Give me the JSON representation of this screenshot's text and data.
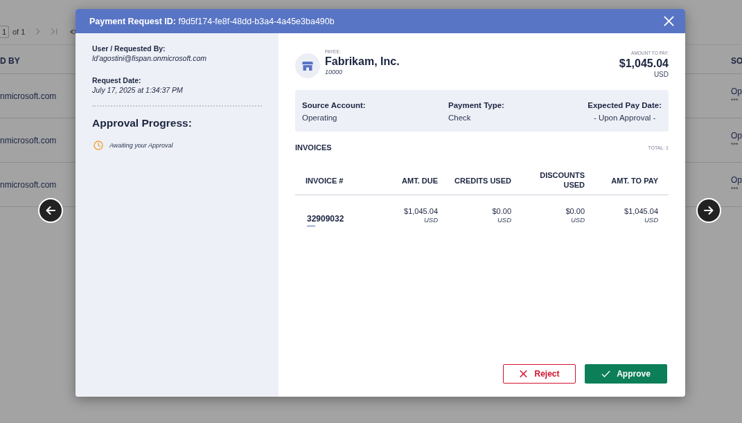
{
  "page": {
    "pagination": {
      "page": "1",
      "of": "of 1"
    },
    "table": {
      "columns": [
        "D BY",
        "SO"
      ],
      "rows": [
        {
          "cells": [
            "nmicrosoft.com",
            "Op"
          ],
          "masked": "***"
        },
        {
          "cells": [
            "nmicrosoft.com",
            "Op"
          ],
          "masked": "***"
        },
        {
          "cells": [
            "nmicrosoft.com",
            "Op"
          ],
          "masked": "***"
        }
      ]
    }
  },
  "modal": {
    "title": "**Payment Request ID:** f9d5f174-fe8f-48dd-b3a4-4a45e3ba490b",
    "details": [
      {
        "label": "User / Requested By:",
        "value": "ld'agostini@fispan.onmicrosoft.com"
      },
      {
        "label": "Request Date:",
        "value": "July 17, 2025 at 1:34:37 PM"
      }
    ],
    "approval_progress": {
      "heading": "Approval Progress:",
      "steps": [
        {
          "label": "Awaiting your Approval",
          "completed": false
        }
      ]
    },
    "payee": {
      "caption": "PAYEE:",
      "name": "Fabrikam, Inc.",
      "id": "10000"
    },
    "amount": {
      "caption": "AMOUNT TO PAY:",
      "value": "$1,045.04",
      "currency": "USD"
    },
    "payment_info": [
      {
        "label": "Source Account:",
        "value": "Operating"
      },
      {
        "label": "Payment Type:",
        "value": "Check"
      },
      {
        "label": "Expected Pay Date:",
        "value": "- Upon Approval -"
      }
    ],
    "invoices": {
      "heading": "INVOICES",
      "total": "TOTAL: 1",
      "columns": [
        "INVOICE #",
        "AMT. DUE",
        "CREDITS USED",
        "DISCOUNTS USED",
        "AMT. TO PAY"
      ],
      "rows": [
        {
          "invoice": "32909032",
          "amounts": [
            {
              "value": "$1,045.04",
              "currency": "USD"
            },
            {
              "value": "$0.00",
              "currency": "USD"
            },
            {
              "value": "$0.00",
              "currency": "USD"
            },
            {
              "value": "$1,045.04",
              "currency": "USD"
            }
          ]
        }
      ]
    },
    "buttons": [
      {
        "label": "Reject",
        "kind": "reject"
      },
      {
        "label": "Approve",
        "kind": "approve"
      }
    ]
  }
}
